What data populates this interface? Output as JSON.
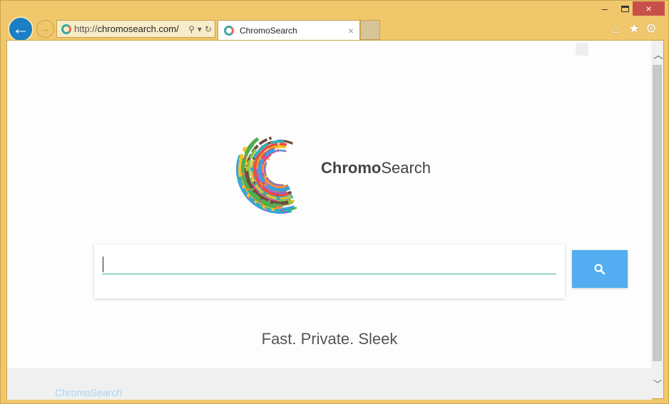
{
  "browser": {
    "url_prefix": "http://",
    "url_domain": "chromosearch.com/",
    "tab_title": "ChromoSearch",
    "back": "←",
    "forward": "→",
    "search_icon": "⚲",
    "dropdown": "▾",
    "refresh": "↻",
    "tab_close": "×",
    "minimize": "–",
    "close": "×",
    "home": "⌂",
    "favorites": "★",
    "settings": "⚙",
    "scroll_up": "︿",
    "scroll_down": "﹀"
  },
  "page": {
    "brand_bold": "Chromo",
    "brand_light": "Search",
    "search_placeholder": "",
    "search_button": "search",
    "tagline": "Fast. Private. Sleek",
    "footer_link": "ChromoSearch"
  },
  "colors": {
    "frame": "#f0c76b",
    "accent": "#53adf0",
    "underline": "#3bb39a"
  }
}
